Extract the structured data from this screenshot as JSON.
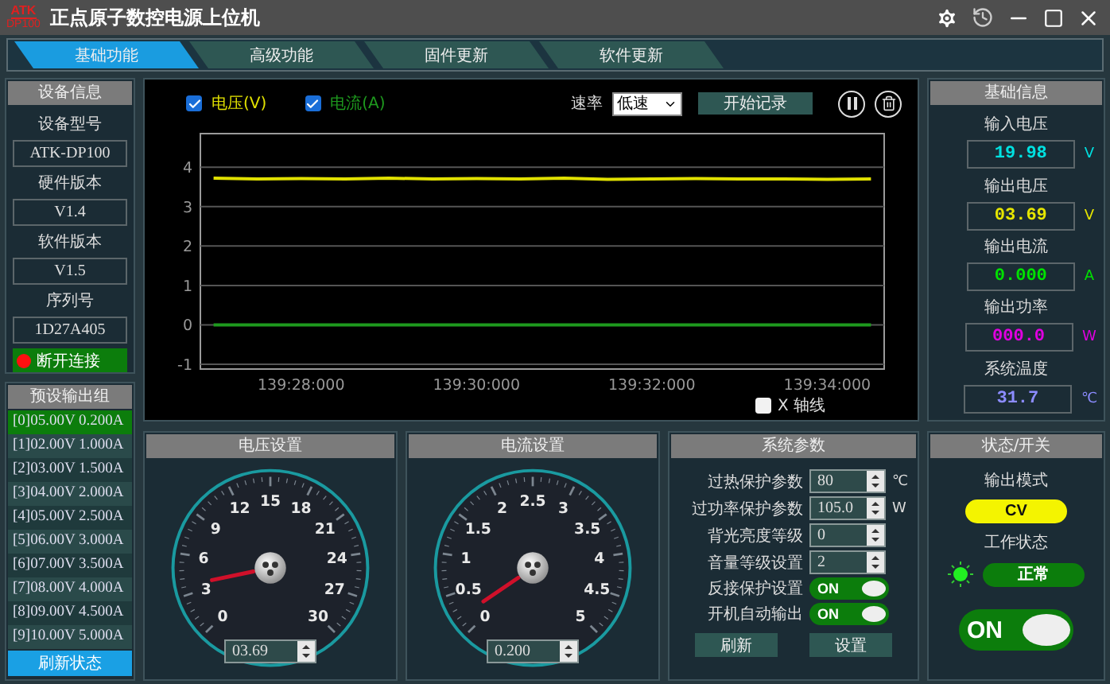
{
  "window": {
    "title": "正点原子数控电源上位机",
    "logo": {
      "top": "ATK",
      "bottom": "DP100"
    }
  },
  "tabs": [
    {
      "label": "基础功能",
      "selected": true
    },
    {
      "label": "高级功能",
      "selected": false
    },
    {
      "label": "固件更新",
      "selected": false
    },
    {
      "label": "软件更新",
      "selected": false
    }
  ],
  "device_info": {
    "title": "设备信息",
    "fields": [
      {
        "label": "设备型号",
        "value": "ATK-DP100"
      },
      {
        "label": "硬件版本",
        "value": "V1.4"
      },
      {
        "label": "软件版本",
        "value": "V1.5"
      },
      {
        "label": "序列号",
        "value": "1D27A405"
      }
    ],
    "connect_button": "断开连接"
  },
  "presets": {
    "title": "预设输出组",
    "items": [
      {
        "label": "[0]05.00V 0.200A",
        "selected": true
      },
      {
        "label": "[1]02.00V 1.000A",
        "selected": false
      },
      {
        "label": "[2]03.00V 1.500A",
        "selected": false
      },
      {
        "label": "[3]04.00V 2.000A",
        "selected": false
      },
      {
        "label": "[4]05.00V 2.500A",
        "selected": false
      },
      {
        "label": "[5]06.00V 3.000A",
        "selected": false
      },
      {
        "label": "[6]07.00V 3.500A",
        "selected": false
      },
      {
        "label": "[7]08.00V 4.000A",
        "selected": false
      },
      {
        "label": "[8]09.00V 4.500A",
        "selected": false
      },
      {
        "label": "[9]10.00V 5.000A",
        "selected": false
      }
    ],
    "refresh_button": "刷新状态"
  },
  "chart_panel": {
    "series_toggles": [
      {
        "checked": true
      },
      {
        "checked": true
      }
    ],
    "rate": {
      "label": "速率",
      "value": "低速"
    },
    "record_button": "开始记录",
    "x_axis_toggle": {
      "label": "X 轴线",
      "checked": false
    },
    "chart_data": {
      "type": "line",
      "categories": [
        null,
        null,
        "139:28:000",
        null,
        null,
        null,
        "139:30:000",
        null,
        null,
        null,
        "139:32:000",
        null,
        null,
        null,
        "139:34:000",
        null
      ],
      "series": [
        {
          "name": "电压(V)",
          "color": "#e0e000",
          "values": [
            3.72,
            3.7,
            3.71,
            3.7,
            3.72,
            3.7,
            3.71,
            3.7,
            3.72,
            3.69,
            3.7,
            3.71,
            3.7,
            3.7,
            3.69,
            3.7
          ]
        },
        {
          "name": "电流(A)",
          "color": "#1e9a1e",
          "values": [
            0,
            0,
            0,
            0,
            0,
            0,
            0,
            0,
            0,
            0,
            0,
            0,
            0,
            0,
            0,
            0
          ]
        }
      ],
      "ylim": [
        -1.12,
        4.85
      ],
      "grid": true,
      "yticks": [
        -1,
        0,
        1,
        2,
        3,
        4
      ]
    }
  },
  "basic_info": {
    "title": "基础信息",
    "items": [
      {
        "label": "输入电压",
        "value": "19.98",
        "unit": "V",
        "color": "#00e0e0"
      },
      {
        "label": "输出电压",
        "value": "03.69",
        "unit": "V",
        "color": "#e6e600"
      },
      {
        "label": "输出电流",
        "value": "0.000",
        "unit": "A",
        "color": "#00e000"
      },
      {
        "label": "输出功率",
        "value": "000.0",
        "unit": "W",
        "color": "#e000e0"
      },
      {
        "label": "系统温度",
        "value": "31.7",
        "unit": "℃",
        "color": "#8c8cff"
      }
    ]
  },
  "voltage_setting": {
    "title": "电压设置",
    "dial_labels": [
      "0",
      "3",
      "6",
      "9",
      "12",
      "15",
      "18",
      "21",
      "24",
      "27",
      "30"
    ],
    "value": "03.69"
  },
  "current_setting": {
    "title": "电流设置",
    "dial_labels": [
      "0",
      "0.5",
      "1",
      "1.5",
      "2",
      "2.5",
      "3",
      "3.5",
      "4",
      "4.5",
      "5"
    ],
    "value": "0.200"
  },
  "system_params": {
    "title": "系统参数",
    "rows": [
      {
        "kind": "number",
        "label": "过热保护参数",
        "value": "80",
        "unit": "℃"
      },
      {
        "kind": "number",
        "label": "过功率保护参数",
        "value": "105.0",
        "unit": "W"
      },
      {
        "kind": "number",
        "label": "背光亮度等级",
        "value": "0"
      },
      {
        "kind": "number",
        "label": "音量等级设置",
        "value": "2"
      },
      {
        "kind": "toggle",
        "label": "反接保护设置",
        "on": true,
        "text": "ON"
      },
      {
        "kind": "toggle",
        "label": "开机自动输出",
        "on": true,
        "text": "ON"
      }
    ],
    "buttons": [
      "刷新",
      "设置"
    ]
  },
  "status": {
    "title": "状态/开关",
    "mode_label": "输出模式",
    "mode": "CV",
    "work_label": "工作状态",
    "work_state": "正常",
    "output_switch": {
      "on": true,
      "text": "ON"
    }
  }
}
